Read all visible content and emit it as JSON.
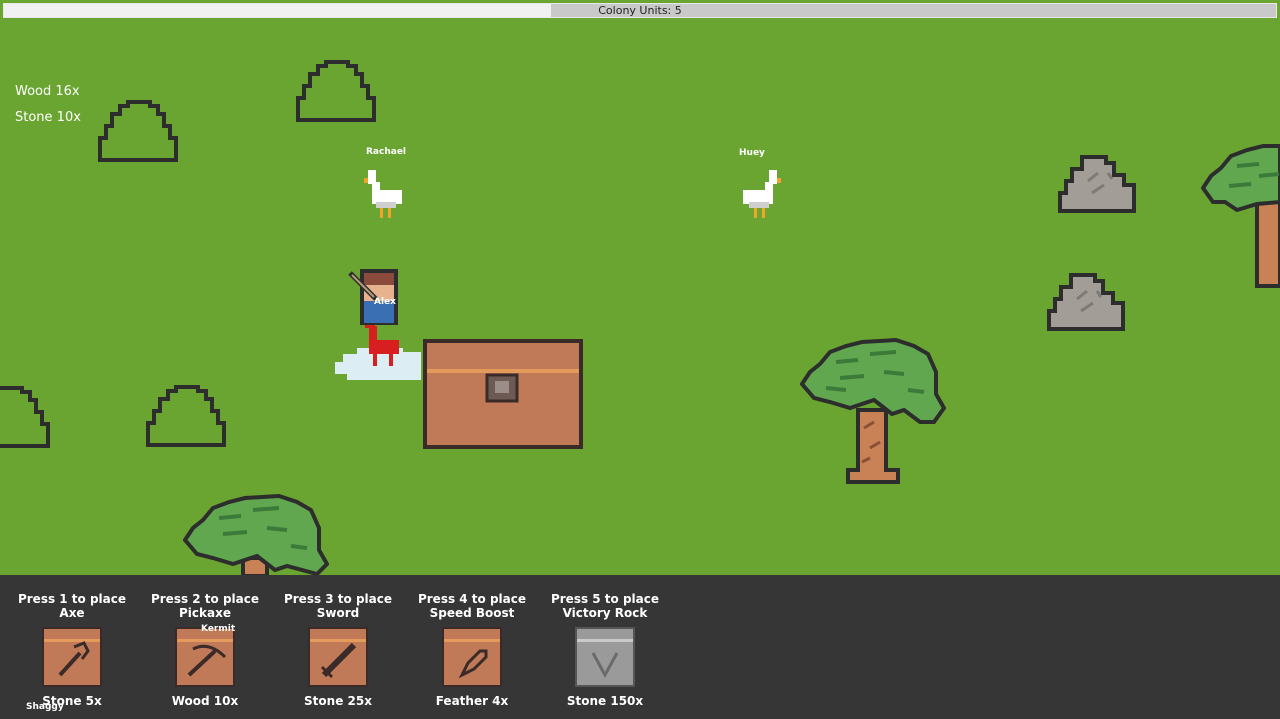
{
  "colony": {
    "label": "Colony Units: 5",
    "progress": 0.43
  },
  "resources": {
    "wood": "Wood 16x",
    "stone": "Stone 10x"
  },
  "units": {
    "rachael": "Rachael",
    "huey": "Huey",
    "alex": "Alex",
    "kermit": "Kermit",
    "shaggy": "Shaggy"
  },
  "build_menu": [
    {
      "line1": "Press 1 to place",
      "line2": "Axe",
      "cost": "Stone 5x",
      "icon": "axe-icon",
      "color": "#c17a57"
    },
    {
      "line1": "Press 2 to place",
      "line2": "Pickaxe",
      "cost": "Wood 10x",
      "icon": "pickaxe-icon",
      "color": "#c17a57"
    },
    {
      "line1": "Press 3 to place",
      "line2": "Sword",
      "cost": "Stone 25x",
      "icon": "sword-icon",
      "color": "#c17a57"
    },
    {
      "line1": "Press 4 to place",
      "line2": "Speed Boost",
      "cost": "Feather 4x",
      "icon": "feather-icon",
      "color": "#c17a57"
    },
    {
      "line1": "Press 5 to place",
      "line2": "Victory Rock",
      "cost": "Stone 150x",
      "icon": "victory-rock-icon",
      "color": "#9a9a9a"
    }
  ],
  "colors": {
    "grass": "#6aa531",
    "hud": "#363636",
    "outline": "#2d2d2d"
  }
}
